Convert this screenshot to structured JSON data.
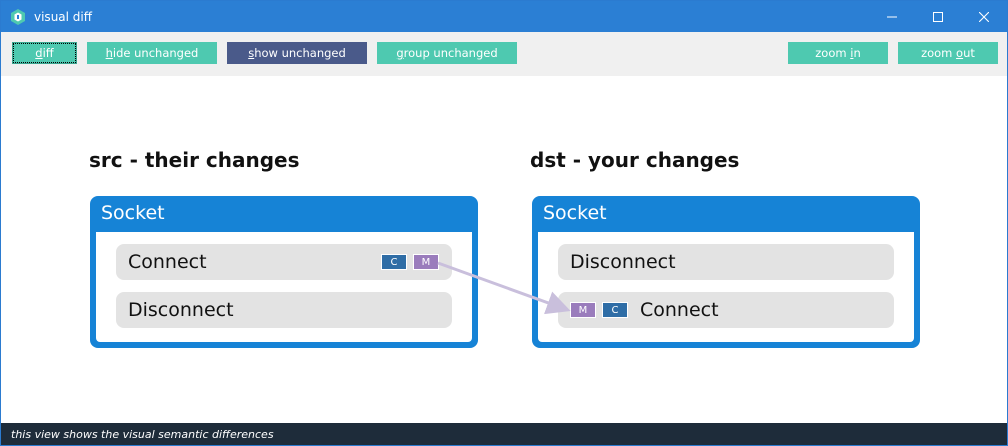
{
  "window": {
    "title": "visual diff",
    "controls": {
      "minimize": "—",
      "maximize": "☐",
      "close": "✕"
    }
  },
  "toolbar": {
    "diff": {
      "key": "d",
      "rest": "iff"
    },
    "hide_unchanged": {
      "key": "h",
      "rest": "ide unchanged"
    },
    "show_unchanged": {
      "key": "s",
      "rest": "how unchanged"
    },
    "group_unchanged": {
      "key": "g",
      "rest": "roup unchanged"
    },
    "zoom_in": {
      "pre": "zoom ",
      "key": "i",
      "rest": "n"
    },
    "zoom_out": {
      "pre": "zoom ",
      "key": "o",
      "rest": "ut"
    }
  },
  "src": {
    "heading": "src - their changes",
    "panel_title": "Socket",
    "items": [
      {
        "label": "Connect",
        "badges": [
          "C",
          "M"
        ]
      },
      {
        "label": "Disconnect"
      }
    ]
  },
  "dst": {
    "heading": "dst - your changes",
    "panel_title": "Socket",
    "items": [
      {
        "label": "Disconnect"
      },
      {
        "label": "Connect",
        "badges": [
          "M",
          "C"
        ]
      }
    ]
  },
  "colors": {
    "titlebar": "#2b7fd4",
    "button_teal": "#4ec9b0",
    "button_active": "#4a5a8a",
    "panel": "#1683d6",
    "badge_c": "#2f6da6",
    "badge_m": "#9a7cbc",
    "move_arrow": "#c9bfdc",
    "statusbar": "#1e2c3a"
  },
  "status": {
    "text": "this view shows the visual semantic differences"
  }
}
